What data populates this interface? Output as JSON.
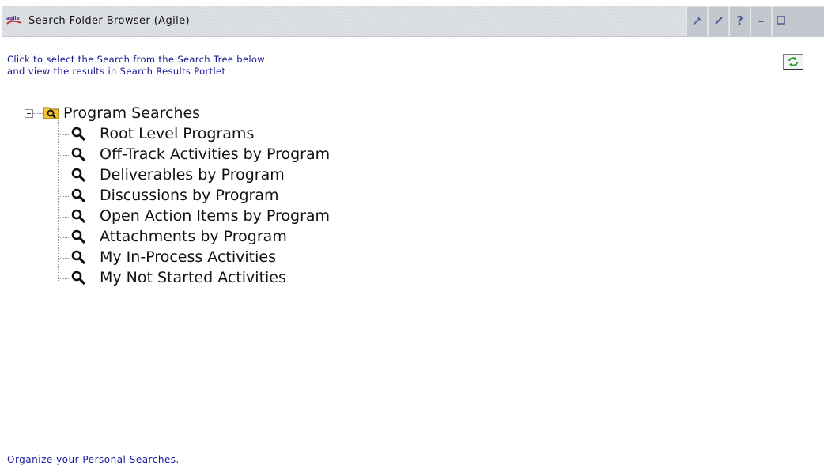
{
  "titlebar": {
    "logo_text": "agile",
    "title": "Search Folder Browser (Agile)",
    "buttons": [
      {
        "name": "configure-button",
        "icon": "wrench-icon"
      },
      {
        "name": "edit-button",
        "icon": "pencil-icon"
      },
      {
        "name": "help-button",
        "label": "?"
      },
      {
        "name": "minimize-button",
        "label": "–"
      },
      {
        "name": "maximize-button",
        "icon": "maximize-icon"
      }
    ]
  },
  "instructions": {
    "line1": "Click to select the Search from the Search Tree below",
    "line2": "and view the results in Search Results Portlet"
  },
  "refresh": {
    "icon": "refresh-icon",
    "color": "#2a9a2a"
  },
  "tree": {
    "root_label": "Program Searches",
    "items": [
      {
        "label": "Root Level Programs"
      },
      {
        "label": "Off-Track Activities by Program"
      },
      {
        "label": "Deliverables by Program"
      },
      {
        "label": "Discussions by Program"
      },
      {
        "label": "Open Action Items by Program"
      },
      {
        "label": "Attachments by Program"
      },
      {
        "label": "My In-Process Activities"
      },
      {
        "label": "My Not Started Activities"
      }
    ]
  },
  "footer": {
    "organize_link": "Organize your Personal Searches."
  },
  "colors": {
    "instruction_text": "#14148f",
    "link": "#1a1aa0",
    "titlebar_bg": "#d6d9dd",
    "folder": "#f0c030"
  }
}
